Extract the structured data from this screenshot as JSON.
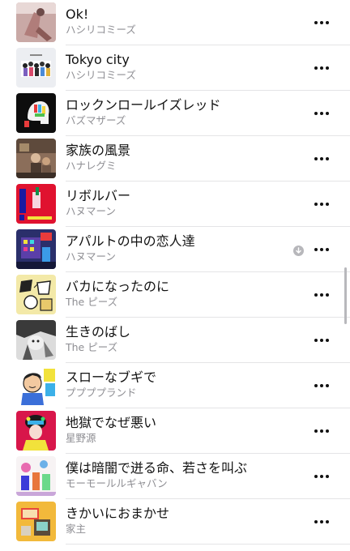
{
  "songs": [
    {
      "title": "Ok!",
      "artist": "ハシリコミーズ",
      "downloaded": false
    },
    {
      "title": "Tokyo city",
      "artist": "ハシリコミーズ",
      "downloaded": false
    },
    {
      "title": "ロックンロールイズレッド",
      "artist": "バズマザーズ",
      "downloaded": false
    },
    {
      "title": "家族の風景",
      "artist": "ハナレグミ",
      "downloaded": false
    },
    {
      "title": "リボルバー",
      "artist": "ハヌマーン",
      "downloaded": false
    },
    {
      "title": "アパルトの中の恋人達",
      "artist": "ハヌマーン",
      "downloaded": true
    },
    {
      "title": "バカになったのに",
      "artist": "The ピーズ",
      "downloaded": false
    },
    {
      "title": "生きのばし",
      "artist": "The ピーズ",
      "downloaded": false
    },
    {
      "title": "スローなブギで",
      "artist": "ププププランド",
      "downloaded": false
    },
    {
      "title": "地獄でなぜ悪い",
      "artist": "星野源",
      "downloaded": false
    },
    {
      "title": "僕は暗闇で迸る命、若さを叫ぶ",
      "artist": "モーモールルギャバン",
      "downloaded": false
    },
    {
      "title": "きかいにおまかせ",
      "artist": "家主",
      "downloaded": false
    }
  ],
  "icons": {
    "more": "more-icon",
    "download": "downloaded-icon"
  },
  "colors": {
    "title": "#111111",
    "subtitle": "#8e8e93",
    "divider": "#e4e4e6"
  }
}
